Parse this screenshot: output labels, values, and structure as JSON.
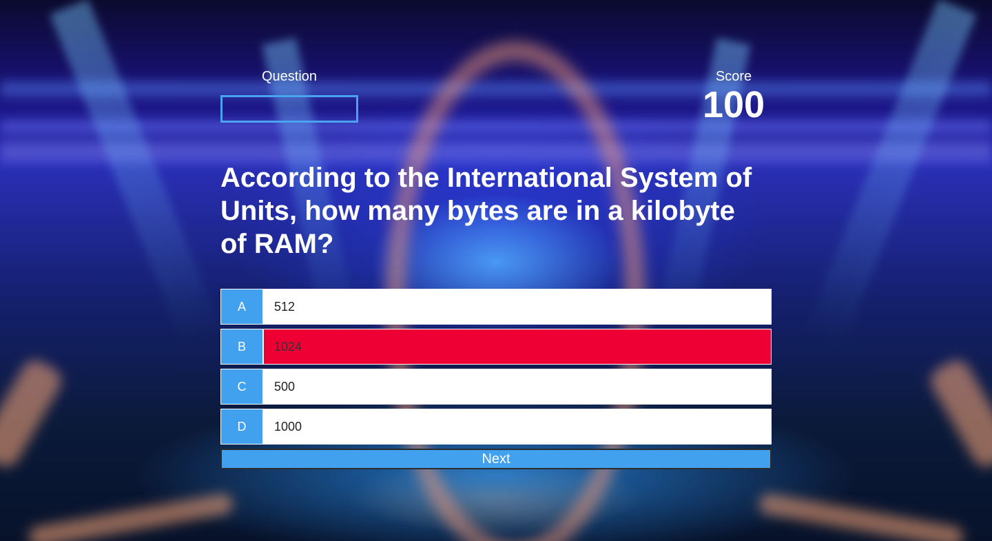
{
  "hud": {
    "question_label": "Question",
    "question_progress": 0,
    "score_label": "Score",
    "score_value": "100"
  },
  "question": {
    "text": "According to the International System of Units, how many bytes are in a kilobyte of RAM?"
  },
  "answers": [
    {
      "letter": "A",
      "text": "512",
      "selected": false
    },
    {
      "letter": "B",
      "text": "1024",
      "selected": true
    },
    {
      "letter": "C",
      "text": "500",
      "selected": false
    },
    {
      "letter": "D",
      "text": "1000",
      "selected": false
    }
  ],
  "next_button": {
    "label": "Next"
  },
  "colors": {
    "accent": "#42a1ee",
    "selected": "#ee0035",
    "answer_bg": "#ffffff"
  }
}
